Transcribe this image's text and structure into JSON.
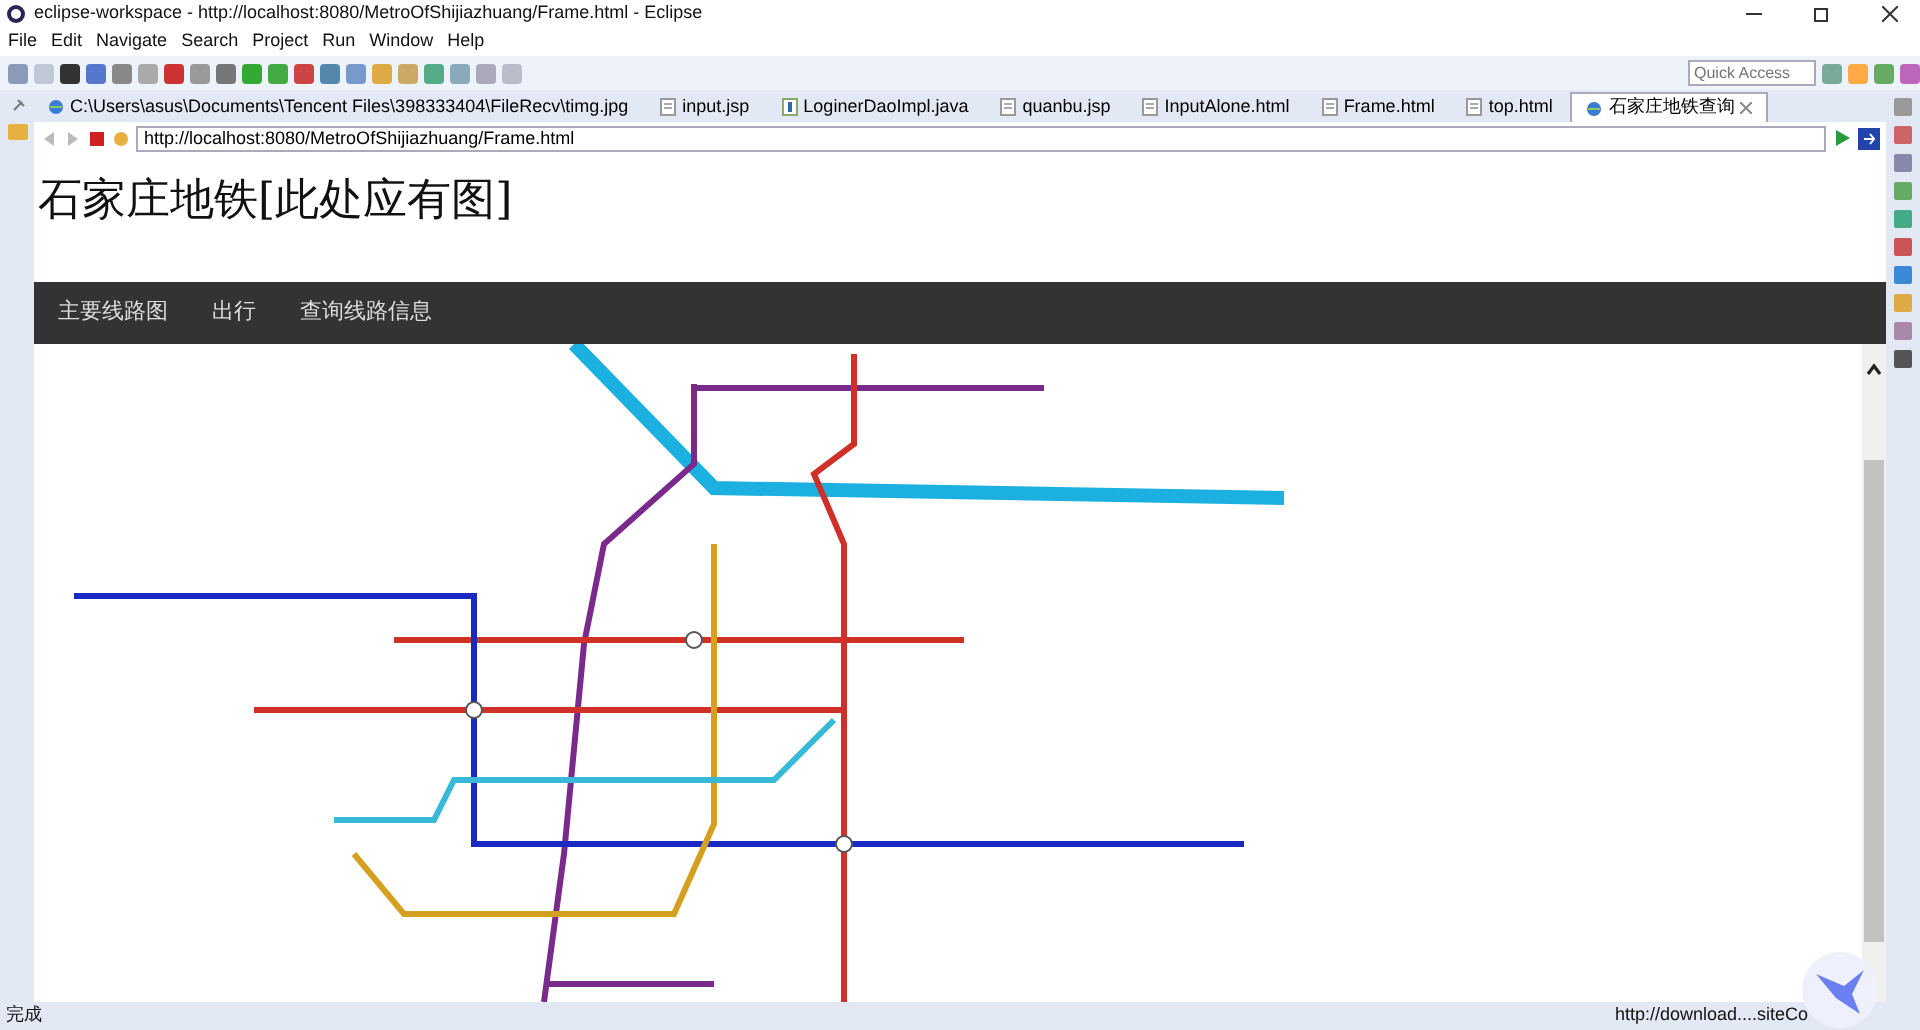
{
  "window": {
    "title": "eclipse-workspace - http://localhost:8080/MetroOfShijiazhuang/Frame.html - Eclipse"
  },
  "menu": [
    "File",
    "Edit",
    "Navigate",
    "Search",
    "Project",
    "Run",
    "Window",
    "Help"
  ],
  "quick_access": {
    "placeholder": "Quick Access"
  },
  "editor_tabs": [
    {
      "label": "C:\\Users\\asus\\Documents\\Tencent Files\\398333404\\FileRecv\\timg.jpg",
      "kind": "web",
      "selected": false
    },
    {
      "label": "input.jsp",
      "kind": "file",
      "selected": false
    },
    {
      "label": "LoginerDaoImpl.java",
      "kind": "java",
      "selected": false
    },
    {
      "label": "quanbu.jsp",
      "kind": "file",
      "selected": false
    },
    {
      "label": "InputAlone.html",
      "kind": "file",
      "selected": false
    },
    {
      "label": "Frame.html",
      "kind": "file",
      "selected": false
    },
    {
      "label": "top.html",
      "kind": "file",
      "selected": false
    },
    {
      "label": "石家庄地铁查询",
      "kind": "web",
      "selected": true
    }
  ],
  "browser": {
    "url": "http://localhost:8080/MetroOfShijiazhuang/Frame.html"
  },
  "page": {
    "heading": "石家庄地铁[此处应有图]",
    "nav": [
      "主要线路图",
      "出行",
      "查询线路信息"
    ]
  },
  "status_bar": {
    "left": "完成",
    "right": "http://download....siteCo"
  }
}
